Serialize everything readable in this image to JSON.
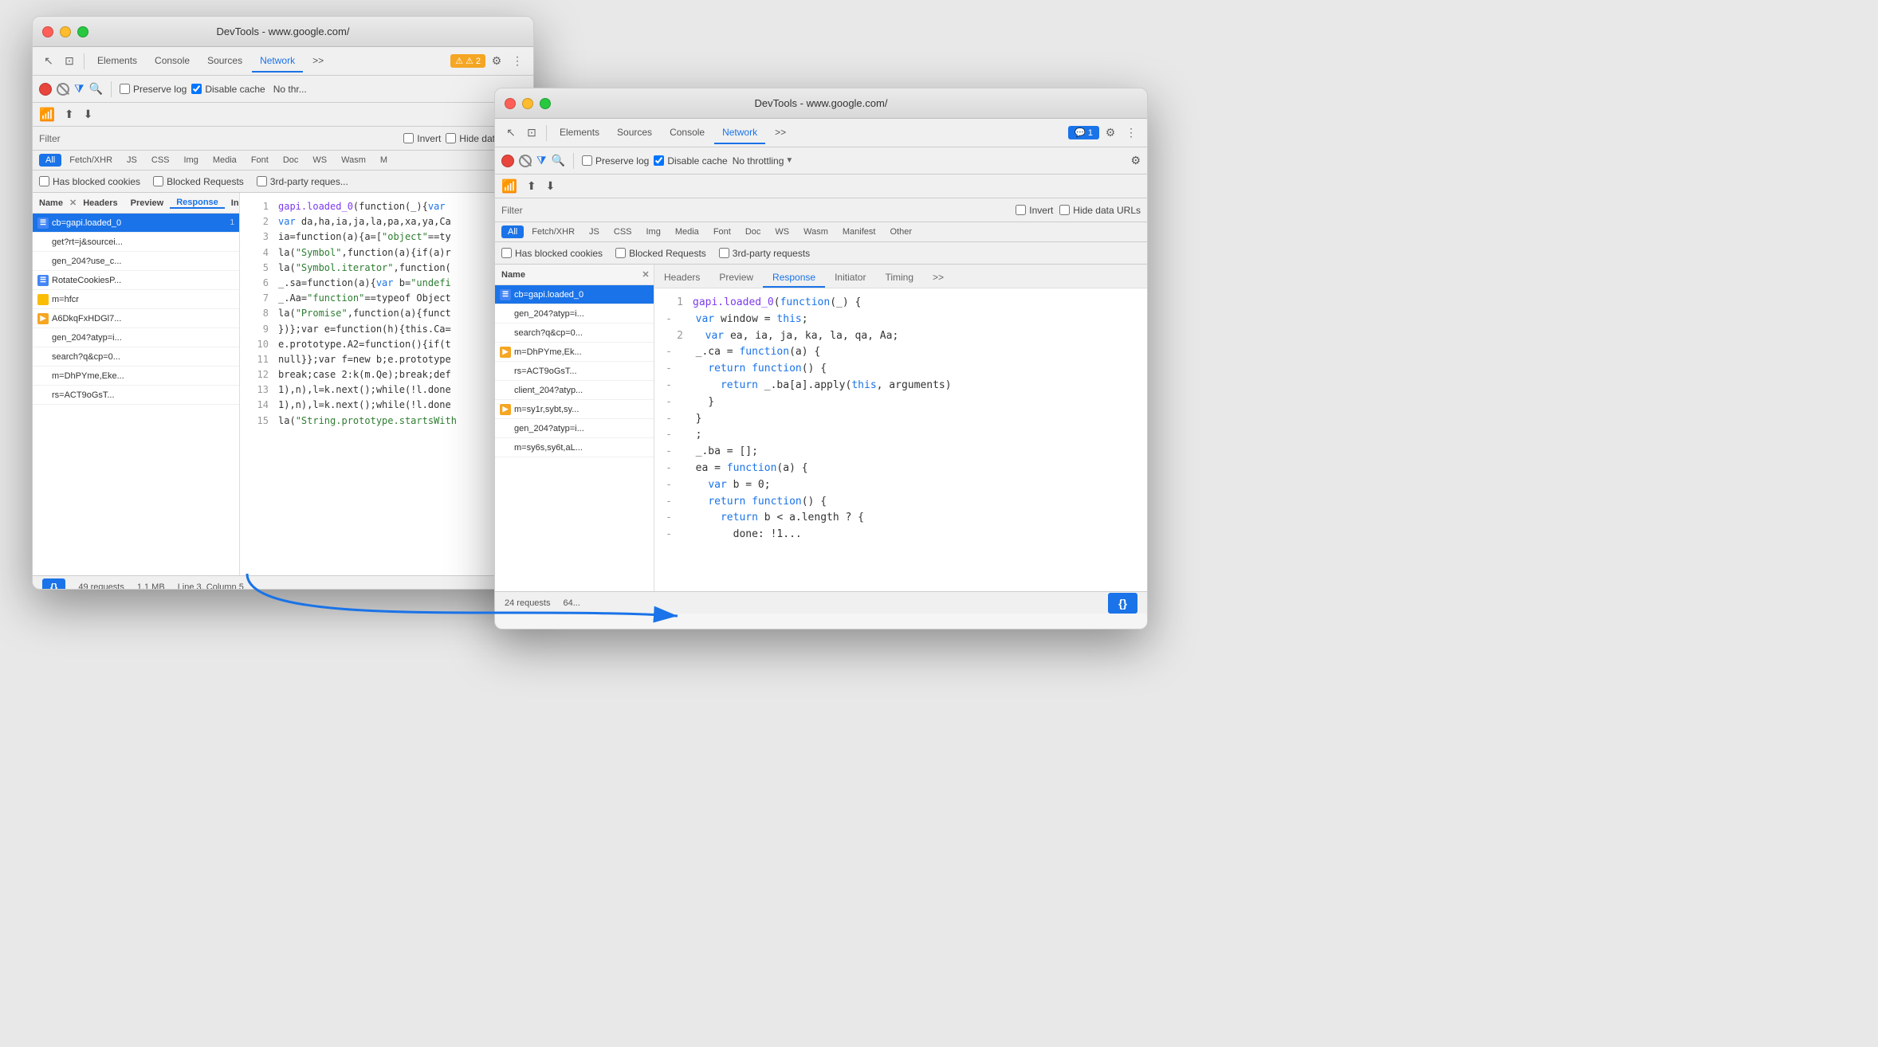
{
  "window1": {
    "title": "DevTools - www.google.com/",
    "tabs": [
      "Elements",
      "Console",
      "Sources",
      "Network",
      ">>"
    ],
    "active_tab": "Network",
    "badge": "⚠ 2",
    "network_controls": {
      "preserve_log": "Preserve log",
      "disable_cache": "Disable cache",
      "no_throttle": "No thr..."
    },
    "filter_label": "Filter",
    "invert_label": "Invert",
    "hide_data_urls": "Hide data URLs",
    "type_filters": [
      "All",
      "Fetch/XHR",
      "JS",
      "CSS",
      "Img",
      "Media",
      "Font",
      "Doc",
      "WS",
      "Wasm",
      "M"
    ],
    "blocked_cookies": "Has blocked cookies",
    "blocked_requests": "Blocked Requests",
    "third_party": "3rd-party reques...",
    "columns": {
      "name": "Name",
      "line_nums": [
        1,
        2,
        3,
        4,
        5,
        6,
        7,
        8,
        9,
        10,
        11,
        12,
        13,
        14,
        15
      ]
    },
    "requests": [
      {
        "name": "cb=gapi.loaded_0",
        "icon": "blue",
        "selected": true
      },
      {
        "name": "get?rt=j&sourcei...",
        "icon": null
      },
      {
        "name": "gen_204?use_c...",
        "icon": null
      },
      {
        "name": "RotateCookiesP...",
        "icon": "blue"
      },
      {
        "name": "m=hfcr",
        "icon": "yellow"
      },
      {
        "name": "A6DkqFxHDGl7...",
        "icon": "orange"
      },
      {
        "name": "gen_204?atyp=i...",
        "icon": null
      },
      {
        "name": "search?q&cp=0...",
        "icon": null
      },
      {
        "name": "m=DhPYme,Eke...",
        "icon": null
      },
      {
        "name": "rs=ACT9oGsT...",
        "icon": null
      }
    ],
    "code_lines": [
      {
        "num": 1,
        "content": "gapi.loaded_0(function(_){var"
      },
      {
        "num": 2,
        "content": "var da,ha,ia,ja,la,pa,xa,ya,Ca"
      },
      {
        "num": 3,
        "content": "ia=function(a){a=[\"object\"==ty"
      },
      {
        "num": 4,
        "content": "la(\"Symbol\",function(a){if(a)r"
      },
      {
        "num": 5,
        "content": "la(\"Symbol.iterator\",function("
      },
      {
        "num": 6,
        "content": "_.sa=function(a){var b=\"undefi"
      },
      {
        "num": 7,
        "content": "_.Aa=\"function\"==typeof Object"
      },
      {
        "num": 8,
        "content": "la(\"Promise\",function(a){funct"
      },
      {
        "num": 9,
        "content": "})};var e=function(h){this.Ca="
      },
      {
        "num": 10,
        "content": "e.prototype.A2=function(){if(t"
      },
      {
        "num": 11,
        "content": "null}};var f=new b;e.prototype"
      },
      {
        "num": 12,
        "content": "break;case 2:k(m.Qe);break;def"
      },
      {
        "num": 13,
        "content": "1),n),l=k.next();while(!l.done"
      },
      {
        "num": 14,
        "content": "1),n),l=k.next();while(!l.done"
      },
      {
        "num": 15,
        "content": "la(\"String.prototype.startsWith"
      }
    ],
    "status": {
      "requests": "49 requests",
      "size": "1.1 MB",
      "position": "Line 3, Column 5"
    }
  },
  "window2": {
    "title": "DevTools - www.google.com/",
    "tabs": [
      "Elements",
      "Sources",
      "Console",
      "Network",
      ">>"
    ],
    "active_tab": "Network",
    "badge_count": "1",
    "network_controls": {
      "preserve_log": "Preserve log",
      "disable_cache": "Disable cache",
      "no_throttle": "No throttling"
    },
    "filter_label": "Filter",
    "invert_label": "Invert",
    "hide_data_urls": "Hide data URLs",
    "type_filters": [
      "All",
      "Fetch/XHR",
      "JS",
      "CSS",
      "Img",
      "Media",
      "Font",
      "Doc",
      "WS",
      "Wasm",
      "Manifest",
      "Other"
    ],
    "blocked_cookies": "Has blocked cookies",
    "blocked_requests": "Blocked Requests",
    "third_party": "3rd-party requests",
    "panel_tabs": [
      "Headers",
      "Preview",
      "Response",
      "Initiator",
      "Timing",
      ">>"
    ],
    "active_panel_tab": "Response",
    "requests": [
      {
        "name": "cb=gapi.loaded_0",
        "icon": "blue",
        "selected": true
      },
      {
        "name": "gen_204?atyp=i...",
        "icon": null
      },
      {
        "name": "search?q&cp=0...",
        "icon": null
      },
      {
        "name": "m=DhPYme,Ek...",
        "icon": "orange"
      },
      {
        "name": "rs=ACT9oGsT...",
        "icon": null
      },
      {
        "name": "client_204?atyp...",
        "icon": null
      },
      {
        "name": "m=sy1r,sybt,sy...",
        "icon": "orange"
      },
      {
        "name": "gen_204?atyp=i...",
        "icon": null
      },
      {
        "name": "m=sy6s,sy6t,aL...",
        "icon": null
      }
    ],
    "code_lines": [
      {
        "num": 1,
        "dash": null,
        "content": "gapi.loaded_0(function(_ ) {"
      },
      {
        "num": 2,
        "dash": "-",
        "content": "  var window = this;"
      },
      {
        "num": 2,
        "dash": "-",
        "content": "  var ea, ia, ja, ka, la, qa, Aa;"
      },
      {
        "num": "-",
        "dash": "-",
        "content": "  _.ca = function(a) {"
      },
      {
        "num": "-",
        "dash": "-",
        "content": "    return function() {"
      },
      {
        "num": "-",
        "dash": "-",
        "content": "      return _.ba[a].apply(this, arguments)"
      },
      {
        "num": "-",
        "dash": "-",
        "content": "    }"
      },
      {
        "num": "-",
        "dash": "-",
        "content": "  }"
      },
      {
        "num": "-",
        "dash": "-",
        "content": "  ;"
      },
      {
        "num": "-",
        "dash": "-",
        "content": "  _.ba = [];"
      },
      {
        "num": "-",
        "dash": "-",
        "content": "  ea = function(a) {"
      },
      {
        "num": "-",
        "dash": "-",
        "content": "    var b = 0;"
      },
      {
        "num": "-",
        "dash": "-",
        "content": "    return function() {"
      },
      {
        "num": "-",
        "dash": "-",
        "content": "      return b < a.length ? {"
      },
      {
        "num": "-",
        "dash": "-",
        "content": "        done: !1..."
      }
    ],
    "status": {
      "requests": "24 requests",
      "size": "64..."
    }
  },
  "icons": {
    "cursor": "↖",
    "layers": "⊡",
    "funnel": "⧩",
    "search": "⌕",
    "gear": "⚙",
    "more": "⋮",
    "wifi": "⊻",
    "upload": "↑",
    "download": "↓",
    "record_stop": "●",
    "no_entry": "⊘",
    "pretty_print": "{}"
  }
}
